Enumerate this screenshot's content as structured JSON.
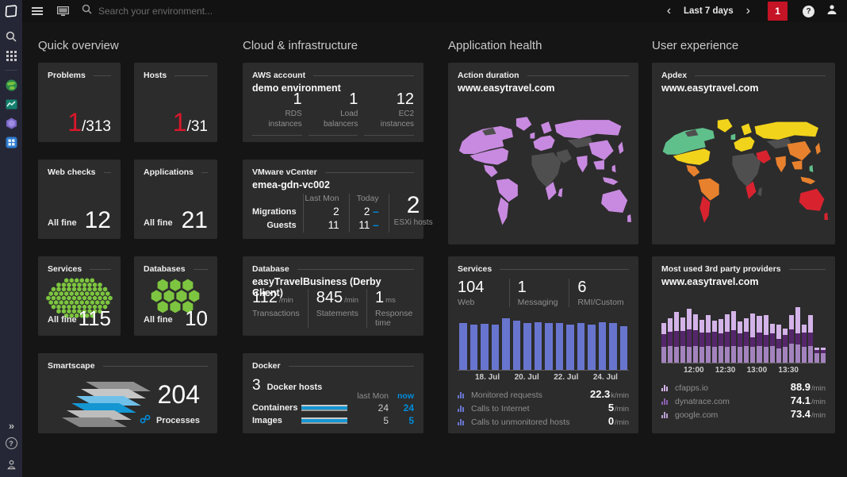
{
  "topbar": {
    "search_placeholder": "Search your environment...",
    "timeframe_label": "Last 7 days",
    "problem_count": "1"
  },
  "icons": {
    "chevron_left": "‹",
    "chevron_right": "›",
    "help": "?",
    "expand": "»"
  },
  "columns": {
    "quick": {
      "title": "Quick overview"
    },
    "cloud": {
      "title": "Cloud & infrastructure"
    },
    "health": {
      "title": "Application health"
    },
    "ux": {
      "title": "User experience"
    }
  },
  "tiles": {
    "problems": {
      "label": "Problems",
      "value": "1",
      "total": "/313"
    },
    "hosts": {
      "label": "Hosts",
      "value": "1",
      "total": "/31"
    },
    "web_checks": {
      "label": "Web checks",
      "status": "All fine",
      "value": "12"
    },
    "applications": {
      "label": "Applications",
      "status": "All fine",
      "value": "21"
    },
    "services": {
      "label": "Services",
      "status": "All fine",
      "value": "115"
    },
    "databases": {
      "label": "Databases",
      "status": "All fine",
      "value": "10"
    },
    "smartscape": {
      "label": "Smartscape",
      "value": "204",
      "unit": "Processes"
    },
    "aws": {
      "label": "AWS account",
      "subtitle": "demo environment",
      "stats": [
        {
          "value": "1",
          "label": "RDS instances"
        },
        {
          "value": "1",
          "label": "Load balancers"
        },
        {
          "value": "12",
          "label": "EC2 instances"
        }
      ]
    },
    "vmware": {
      "label": "VMware vCenter",
      "subtitle": "emea-gdn-vc002",
      "col_last": "Last Mon",
      "col_today": "Today",
      "dash": "–",
      "rows": [
        {
          "label": "Migrations",
          "last": "2",
          "today": "2"
        },
        {
          "label": "Guests",
          "last": "11",
          "today": "11"
        }
      ],
      "big_value": "2",
      "big_label": "ESXi hosts"
    },
    "database": {
      "label": "Database",
      "subtitle": "easyTravelBusiness (Derby Client)",
      "stats": [
        {
          "value": "112",
          "unit": "/min",
          "label": "Transactions"
        },
        {
          "value": "845",
          "unit": "/min",
          "label": "Statements"
        },
        {
          "value": "1",
          "unit": "ms",
          "label": "Response time"
        }
      ]
    },
    "docker": {
      "label": "Docker",
      "hosts_value": "3",
      "hosts_label": "Docker hosts",
      "col_last": "last Mon",
      "col_now": "now",
      "rows": [
        {
          "label": "Containers",
          "last": "24",
          "now": "24"
        },
        {
          "label": "Images",
          "last": "5",
          "now": "5"
        }
      ]
    },
    "action_duration": {
      "label": "Action duration",
      "subtitle": "www.easytravel.com"
    },
    "app_services": {
      "label": "Services",
      "stats": [
        {
          "value": "104",
          "label": "Web"
        },
        {
          "value": "1",
          "label": "Messaging"
        },
        {
          "value": "6",
          "label": "RMI/Custom"
        }
      ]
    },
    "apdex": {
      "label": "Apdex",
      "subtitle": "www.easytravel.com"
    },
    "providers": {
      "label": "Most used 3rd party providers",
      "subtitle": "www.easytravel.com"
    }
  },
  "colors": {
    "accent_blue": "#008cdb",
    "problem_red": "#dc172a",
    "healthy_green": "#7dc540",
    "docker_bar_blue": "#1496d2",
    "services_bar_blue": "#6875cf",
    "map_purple": "#c88ae0",
    "map_gray": "#4f4f4f",
    "apdex_yellow": "#f2d31b",
    "apdex_green": "#5fc08c",
    "apdex_orange": "#e8812d",
    "apdex_red": "#d8232f",
    "provider_purple_light": "#d3b3e8",
    "provider_purple_dark": "#55266b",
    "provider_purple_mid": "#a383bd"
  },
  "chart_data": [
    {
      "name": "services_requests",
      "type": "bar",
      "title": "Services — monitored requests over last 7 days",
      "x_ticks": [
        "18. Jul",
        "20. Jul",
        "22. Jul",
        "24. Jul"
      ],
      "ylim": [
        0,
        72
      ],
      "color": "#6875cf",
      "values": [
        62,
        60,
        61,
        60,
        68,
        65,
        62,
        63,
        62,
        62,
        60,
        62,
        60,
        63,
        62,
        57
      ],
      "legend": [
        {
          "label": "Monitored requests",
          "value": "22.3",
          "unit": "k/min",
          "icon_color": "#6875cf"
        },
        {
          "label": "Calls to Internet",
          "value": "5",
          "unit": "/min",
          "icon_color": "#6875cf"
        },
        {
          "label": "Calls to unmonitored hosts",
          "value": "0",
          "unit": "/min",
          "icon_color": "#6875cf"
        }
      ]
    },
    {
      "name": "third_party_providers",
      "type": "stacked-bar",
      "title": "Most used 3rd party providers — www.easytravel.com",
      "x_ticks": [
        "12:00",
        "12:30",
        "13:00",
        "13:30"
      ],
      "series": [
        {
          "name": "base",
          "color": "#a383bd",
          "values": [
            20,
            21,
            20,
            21,
            20,
            21,
            20,
            21,
            20,
            21,
            20,
            21,
            20,
            21,
            20,
            21,
            20,
            21,
            18,
            20,
            24,
            23,
            20,
            21,
            12,
            12
          ]
        },
        {
          "name": "mid",
          "color": "#55266b",
          "values": [
            16,
            18,
            20,
            19,
            22,
            20,
            18,
            17,
            19,
            16,
            19,
            20,
            17,
            18,
            12,
            17,
            15,
            16,
            12,
            15,
            18,
            14,
            18,
            17,
            4,
            4
          ]
        },
        {
          "name": "top",
          "color": "#d3b3e8",
          "values": [
            14,
            17,
            24,
            17,
            26,
            20,
            16,
            22,
            14,
            18,
            22,
            24,
            15,
            17,
            30,
            21,
            25,
            12,
            18,
            8,
            18,
            33,
            10,
            22,
            3,
            3
          ]
        }
      ],
      "legend": [
        {
          "label": "cfapps.io",
          "value": "88.9",
          "unit": "/min",
          "icon_color": "#d3b3e8"
        },
        {
          "label": "dynatrace.com",
          "value": "74.1",
          "unit": "/min",
          "icon_color": "#8a5fae"
        },
        {
          "label": "google.com",
          "value": "73.4",
          "unit": "/min",
          "icon_color": "#b79ed0"
        }
      ]
    },
    {
      "name": "action_duration_map",
      "type": "choropleth",
      "title": "Action duration — www.easytravel.com",
      "regions": {
        "alaska_canada": "#c88ae0",
        "canada_north": "#4f4f4f",
        "usa": "#c88ae0",
        "mexico": "#c88ae0",
        "greenland": "#c88ae0",
        "sa_north": "#c88ae0",
        "sa_south": "#c88ae0",
        "europe": "#c88ae0",
        "scandinavia": "#c88ae0",
        "uk": "#c88ae0",
        "africa_north": "#4f4f4f",
        "africa_south": "#c88ae0",
        "madagascar": "#c88ae0",
        "russia": "#c88ae0",
        "central_asia": "#4f4f4f",
        "middle_east": "#4f4f4f",
        "india": "#c88ae0",
        "china": "#c88ae0",
        "se_asia": "#c88ae0",
        "indonesia": "#c88ae0",
        "philippines": "#c88ae0",
        "japan": "#c88ae0",
        "australia": "#c88ae0",
        "new_zealand": "#c88ae0"
      }
    },
    {
      "name": "apdex_map",
      "type": "choropleth",
      "title": "Apdex — www.easytravel.com",
      "regions": {
        "alaska_canada": "#5fc08c",
        "canada_north": "#4f4f4f",
        "usa": "#f2d31b",
        "mexico": "#e8812d",
        "greenland": "#f2d31b",
        "sa_north": "#e8812d",
        "sa_south": "#d8232f",
        "europe": "#f2d31b",
        "scandinavia": "#f2d31b",
        "uk": "#5fc08c",
        "africa_north": "#4f4f4f",
        "africa_south": "#d8232f",
        "madagascar": "#4f4f4f",
        "russia": "#f2d31b",
        "central_asia": "#4f4f4f",
        "middle_east": "#d8232f",
        "india": "#e8812d",
        "china": "#e8812d",
        "se_asia": "#e8812d",
        "indonesia": "#e8812d",
        "philippines": "#5fc08c",
        "japan": "#e8812d",
        "australia": "#d8232f",
        "new_zealand": "#d8232f"
      }
    }
  ]
}
